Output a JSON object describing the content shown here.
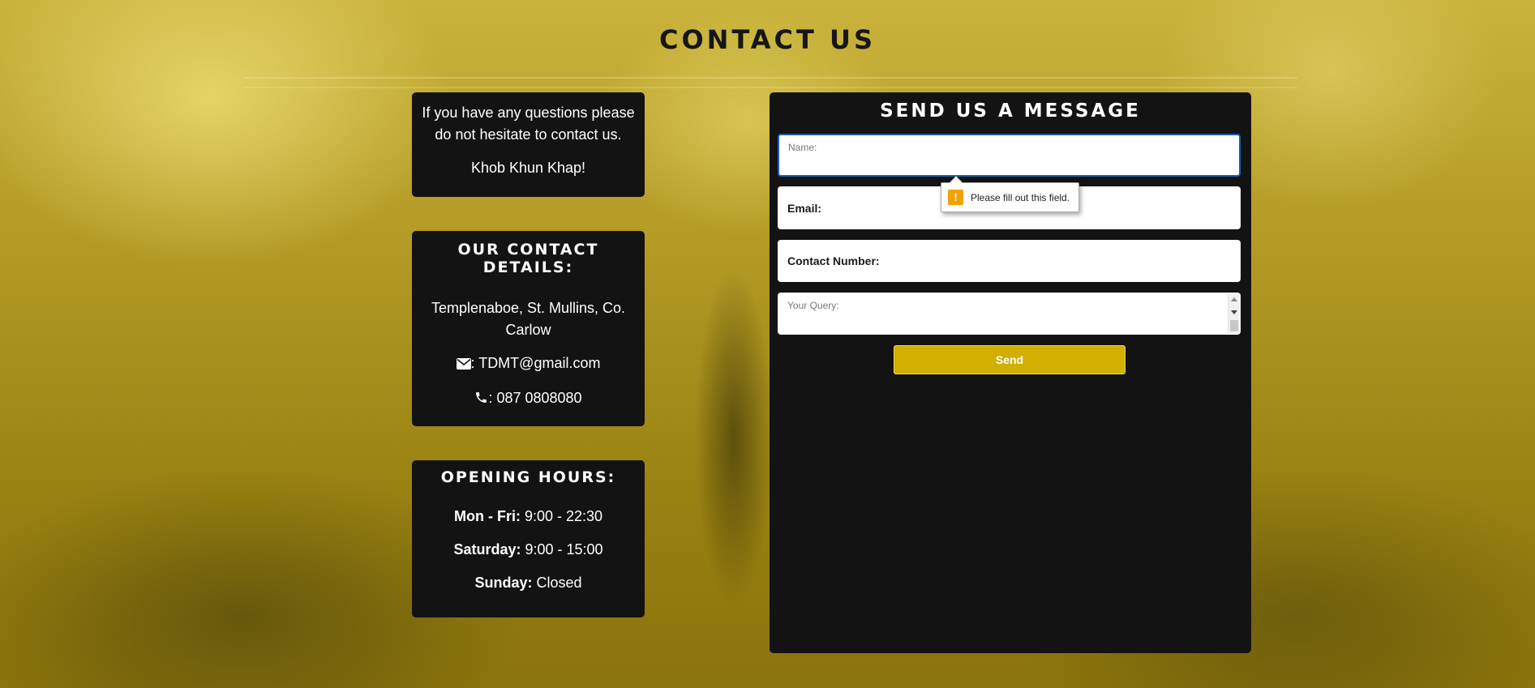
{
  "page": {
    "title": "CONTACT US"
  },
  "intro": {
    "line1": "If you have any questions please do not hesitate to contact us.",
    "line2": "Khob Khun Khap!"
  },
  "contact": {
    "heading": "OUR CONTACT DETAILS:",
    "address": "Templenaboe, St. Mullins, Co. Carlow",
    "email": ": TDMT@gmail.com",
    "email_icon": "envelope-icon",
    "phone": ": 087 0808080",
    "phone_icon": "phone-icon"
  },
  "hours": {
    "heading": "OPENING HOURS:",
    "rows": [
      {
        "day": "Mon - Fri:",
        "time": " 9:00 - 22:30"
      },
      {
        "day": "Saturday:",
        "time": " 9:00 - 15:00"
      },
      {
        "day": "Sunday:",
        "time": " Closed"
      }
    ]
  },
  "form": {
    "title": "SEND US A MESSAGE",
    "name_placeholder": "Name:",
    "email_label": "Email:",
    "phone_label": "Contact Number:",
    "query_placeholder": "Your Query:",
    "send_label": "Send"
  },
  "validation": {
    "message": "Please fill out this field.",
    "icon": "warning-icon"
  },
  "colors": {
    "accent": "#d1ae00",
    "panel": "#131313",
    "focus": "#1a5fb4",
    "warning": "#f4a000"
  }
}
